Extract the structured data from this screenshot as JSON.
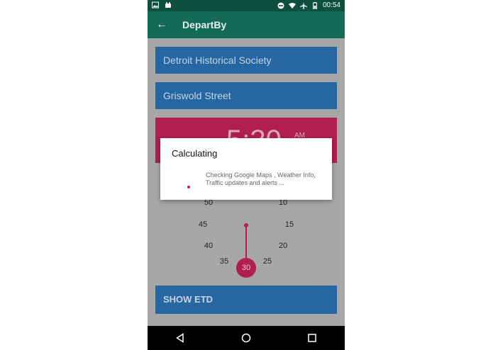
{
  "status_bar": {
    "time": "00:54"
  },
  "app_bar": {
    "title": "DepartBy"
  },
  "form": {
    "from": "Detroit Historical Society",
    "to": "Griswold Street",
    "time": "5:30",
    "ampm": "AM",
    "dial_numbers": [
      "10",
      "15",
      "20",
      "25",
      "30",
      "35",
      "40",
      "45",
      "50"
    ],
    "selected_minute": "30",
    "show_etd_label": "SHOW ETD"
  },
  "dialog": {
    "title": "Calculating",
    "message": "Checking Google Maps , Weather Info, Traffic updates and alerts ..."
  },
  "colors": {
    "app_bar": "#126b55",
    "field": "#2566a3",
    "accent": "#b01e52"
  }
}
